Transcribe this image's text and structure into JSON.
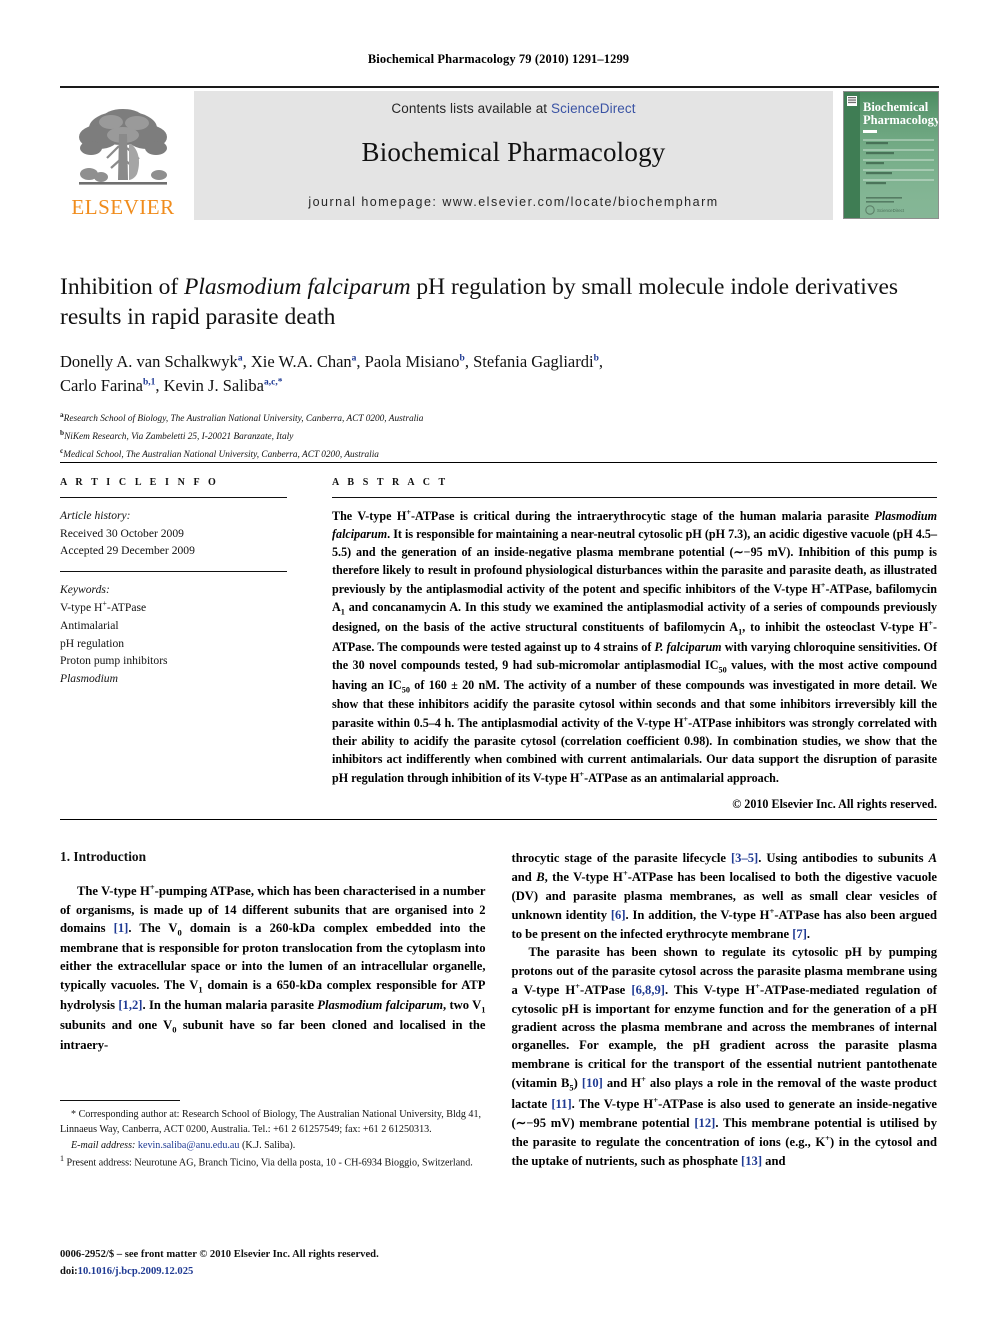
{
  "running_head": "Biochemical Pharmacology 79 (2010) 1291–1299",
  "masthead": {
    "contents_prefix": "Contents lists available at ",
    "sciencedirect_link": "ScienceDirect",
    "journal_title": "Biochemical Pharmacology",
    "homepage_line": "journal homepage: www.elsevier.com/locate/biochempharm",
    "publisher_logo_text": "ELSEVIER",
    "cover_title_line1": "Biochemical",
    "cover_title_line2": "Pharmacology",
    "cover_footer": "ScienceDirect",
    "colors": {
      "band_background": "#e4e4e4",
      "link_blue": "#3a53a4",
      "elsevier_orange": "#F08C1C",
      "cover_green": "#3f7d54"
    }
  },
  "article": {
    "title_part1": "Inhibition of ",
    "title_species": "Plasmodium falciparum",
    "title_part2": " pH regulation by small molecule indole derivatives results in rapid parasite death",
    "authors": [
      {
        "name": "Donelly A. van Schalkwyk",
        "marks": "a"
      },
      {
        "name": "Xie W.A. Chan",
        "marks": "a"
      },
      {
        "name": "Paola Misiano",
        "marks": "b"
      },
      {
        "name": "Stefania Gagliardi",
        "marks": "b"
      },
      {
        "name": "Carlo Farina",
        "marks": "b,1"
      },
      {
        "name": "Kevin J. Saliba",
        "marks": "a,c,*"
      }
    ],
    "affiliations": [
      {
        "mark": "a",
        "text": "Research School of Biology, The Australian National University, Canberra, ACT 0200, Australia"
      },
      {
        "mark": "b",
        "text": "NiKem Research, Via Zambeletti 25, I-20021 Baranzate, Italy"
      },
      {
        "mark": "c",
        "text": "Medical School, The Australian National University, Canberra, ACT 0200, Australia"
      }
    ]
  },
  "article_info": {
    "eyebrow": "A R T I C L E  I N F O",
    "history_label": "Article history:",
    "history_lines": [
      "Received 30 October 2009",
      "Accepted 29 December 2009"
    ],
    "keywords_label": "Keywords:",
    "keywords": [
      "V-type H+-ATPase",
      "Antimalarial",
      "pH regulation",
      "Proton pump inhibitors",
      "Plasmodium"
    ]
  },
  "abstract": {
    "eyebrow": "A B S T R A C T",
    "text": "The V-type H+-ATPase is critical during the intraerythrocytic stage of the human malaria parasite Plasmodium falciparum. It is responsible for maintaining a near-neutral cytosolic pH (pH 7.3), an acidic digestive vacuole (pH 4.5–5.5) and the generation of an inside-negative plasma membrane potential (~−95 mV). Inhibition of this pump is therefore likely to result in profound physiological disturbances within the parasite and parasite death, as illustrated previously by the antiplasmodial activity of the potent and specific inhibitors of the V-type H+-ATPase, bafilomycin A1 and concanamycin A. In this study we examined the antiplasmodial activity of a series of compounds previously designed, on the basis of the active structural constituents of bafilomycin A1, to inhibit the osteoclast V-type H+-ATPase. The compounds were tested against up to 4 strains of P. falciparum with varying chloroquine sensitivities. Of the 30 novel compounds tested, 9 had sub-micromolar antiplasmodial IC50 values, with the most active compound having an IC50 of 160 ± 20 nM. The activity of a number of these compounds was investigated in more detail. We show that these inhibitors acidify the parasite cytosol within seconds and that some inhibitors irreversibly kill the parasite within 0.5–4 h. The antiplasmodial activity of the V-type H+-ATPase inhibitors was strongly correlated with their ability to acidify the parasite cytosol (correlation coefficient 0.98). In combination studies, we show that the inhibitors act indifferently when combined with current antimalarials. Our data support the disruption of parasite pH regulation through inhibition of its V-type H+-ATPase as an antimalarial approach.",
    "copyright": "© 2010 Elsevier Inc. All rights reserved."
  },
  "introduction": {
    "heading": "1. Introduction",
    "paragraph_1": "The V-type H+-pumping ATPase, which has been characterised in a number of organisms, is made up of 14 different subunits that are organised into 2 domains [1]. The V0 domain is a 260-kDa complex embedded into the membrane that is responsible for proton translocation from the cytoplasm into either the extracellular space or into the lumen of an intracellular organelle, typically vacuoles. The V1 domain is a 650-kDa complex responsible for ATP hydrolysis [1,2]. In the human malaria parasite Plasmodium falciparum, two V1 subunits and one V0 subunit have so far been cloned and localised in the intraerythrocytic stage of the parasite lifecycle [3–5]. Using antibodies to subunits A and B, the V-type H+-ATPase has been localised to both the digestive vacuole (DV) and parasite plasma membranes, as well as small clear vesicles of unknown identity [6]. In addition, the V-type H+-ATPase has also been argued to be present on the infected erythrocyte membrane [7].",
    "paragraph_2": "The parasite has been shown to regulate its cytosolic pH by pumping protons out of the parasite cytosol across the parasite plasma membrane using a V-type H+-ATPase [6,8,9]. This V-type H+-ATPase-mediated regulation of cytosolic pH is important for enzyme function and for the generation of a pH gradient across the plasma membrane and across the membranes of internal organelles. For example, the pH gradient across the parasite plasma membrane is critical for the transport of the essential nutrient pantothenate (vitamin B5) [10] and H+ also plays a role in the removal of the waste product lactate [11]. The V-type H+-ATPase is also used to generate an inside-negative (~−95 mV) membrane potential [12]. This membrane potential is utilised by the parasite to regulate the concentration of ions (e.g., K+) in the cytosol and the uptake of nutrients, such as phosphate [13] and"
  },
  "footnotes": {
    "corresponding": "* Corresponding author at: Research School of Biology, The Australian National University, Bldg 41, Linnaeus Way, Canberra, ACT 0200, Australia. Tel.: +61 2 61257549; fax: +61 2 61250313.",
    "email_label": "E-mail address:",
    "email_link": "kevin.saliba@anu.edu.au",
    "email_suffix": " (K.J. Saliba).",
    "present_address": "1 Present address: Neurotune AG, Branch Ticino, Via della posta, 10 - CH-6934 Bioggio, Switzerland."
  },
  "imprint": {
    "issn_line": "0006-2952/$ – see front matter © 2010 Elsevier Inc. All rights reserved.",
    "doi_prefix": "doi:",
    "doi_value": "10.1016/j.bcp.2009.12.025"
  }
}
